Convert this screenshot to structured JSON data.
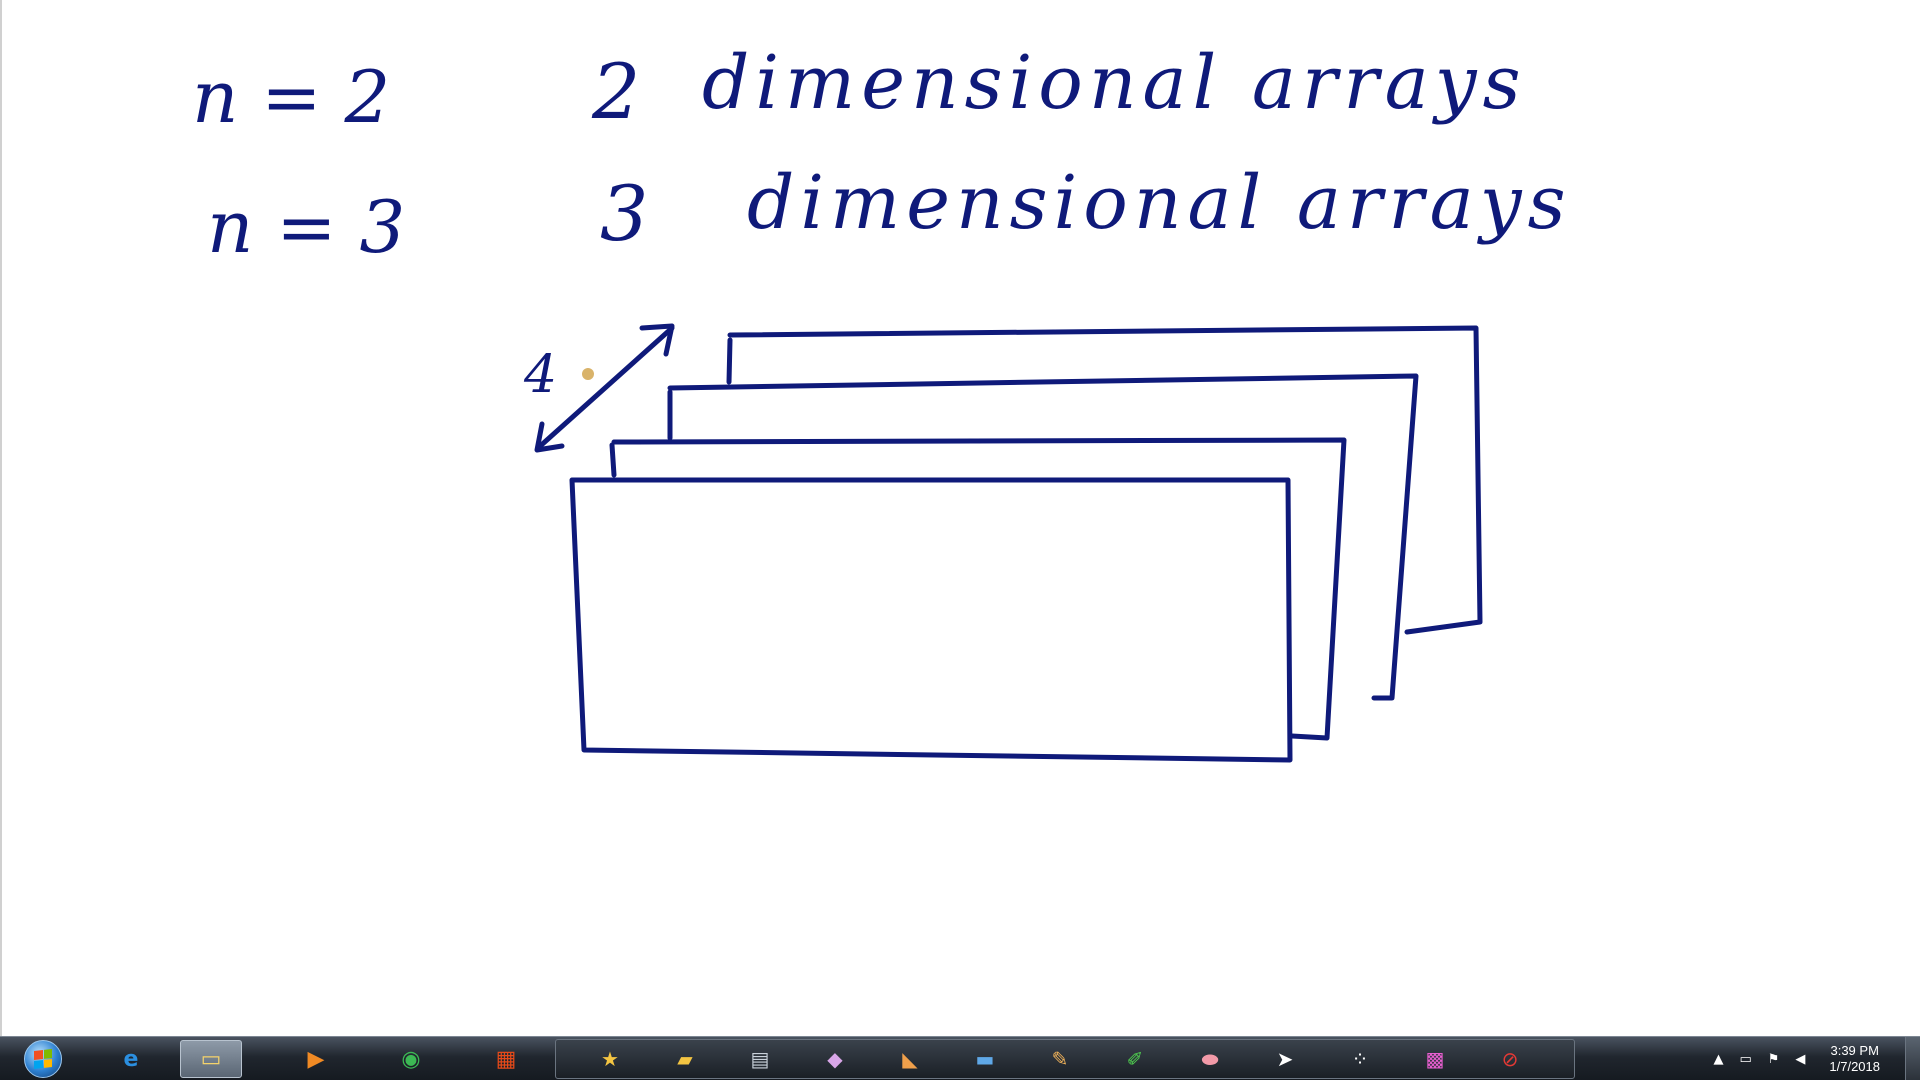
{
  "whiteboard": {
    "line1": {
      "left": "n = 2",
      "right_num": "2",
      "right_text": "dimensional arrays"
    },
    "line2": {
      "left": "n = 3",
      "right_num": "3",
      "right_text": "dimensional arrays"
    },
    "depth_label": "4",
    "ink_color": "#0f1a7a"
  },
  "taskbar": {
    "pinned": [
      {
        "name": "internet-explorer-icon",
        "glyph": "e",
        "color": "#2b8fe0"
      },
      {
        "name": "file-explorer-icon",
        "glyph": "▭",
        "color": "#f4d36b"
      },
      {
        "name": "media-player-icon",
        "glyph": "▶",
        "color": "#f08a24"
      },
      {
        "name": "chrome-icon",
        "glyph": "◉",
        "color": "#3cba54"
      },
      {
        "name": "windows-apps-icon",
        "glyph": "▦",
        "color": "#e64a19"
      }
    ],
    "pen_tools": [
      {
        "name": "star-icon",
        "glyph": "★",
        "color": "#f4c542"
      },
      {
        "name": "folder-icon",
        "glyph": "▰",
        "color": "#f4c542"
      },
      {
        "name": "save-icon",
        "glyph": "▤",
        "color": "#c9d1da"
      },
      {
        "name": "eraser-icon",
        "glyph": "◆",
        "color": "#d9a6e8"
      },
      {
        "name": "book-icon",
        "glyph": "◣",
        "color": "#f0a04b"
      },
      {
        "name": "screen-icon",
        "glyph": "▬",
        "color": "#5fa8e8"
      },
      {
        "name": "pencil-icon",
        "glyph": "✎",
        "color": "#f1b35a"
      },
      {
        "name": "highlighter-icon",
        "glyph": "✐",
        "color": "#4fd04f"
      },
      {
        "name": "eraser-pink-icon",
        "glyph": "⬬",
        "color": "#f29aa8"
      },
      {
        "name": "cursor-icon",
        "glyph": "➤",
        "color": "#ffffff"
      },
      {
        "name": "shapes-icon",
        "glyph": "⁘",
        "color": "#ffffff"
      },
      {
        "name": "color-palette-icon",
        "glyph": "▩",
        "color": "#e85fd0"
      },
      {
        "name": "clear-icon",
        "glyph": "⊘",
        "color": "#e53935"
      }
    ],
    "tray_icons": [
      {
        "name": "show-hidden-icon",
        "glyph": "▲"
      },
      {
        "name": "network-icon",
        "glyph": "▭"
      },
      {
        "name": "action-center-flag-icon",
        "glyph": "⚑"
      },
      {
        "name": "volume-icon",
        "glyph": "◀"
      }
    ],
    "clock": {
      "time": "3:39 PM",
      "date": "1/7/2018"
    }
  }
}
